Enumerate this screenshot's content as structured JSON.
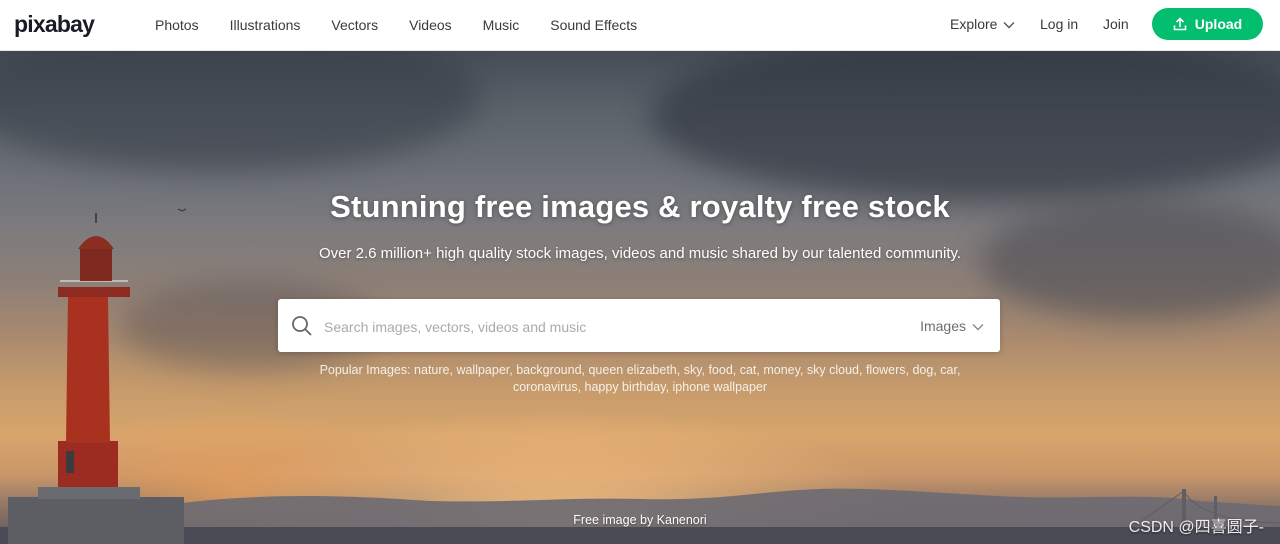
{
  "header": {
    "logo": "pixabay",
    "nav": [
      "Photos",
      "Illustrations",
      "Vectors",
      "Videos",
      "Music",
      "Sound Effects"
    ],
    "explore_label": "Explore",
    "login_label": "Log in",
    "join_label": "Join",
    "upload_label": "Upload"
  },
  "hero": {
    "headline": "Stunning free images & royalty free stock",
    "subheadline": "Over 2.6 million+ high quality stock images, videos and music shared by our talented community.",
    "search_placeholder": "Search images, vectors, videos and music",
    "search_type": "Images",
    "popular_text": "Popular Images: nature, wallpaper, background, queen elizabeth, sky, food, cat, money, sky cloud, flowers, dog, car, coronavirus, happy birthday, iphone wallpaper",
    "credit": "Free image by Kanenori",
    "watermark": "CSDN @四喜圆子-"
  },
  "colors": {
    "brand_green": "#02be6e",
    "text_dark": "#191b26"
  },
  "icons": {
    "upload": "upload-icon",
    "search": "search-icon",
    "chevron": "chevron-down-icon"
  }
}
